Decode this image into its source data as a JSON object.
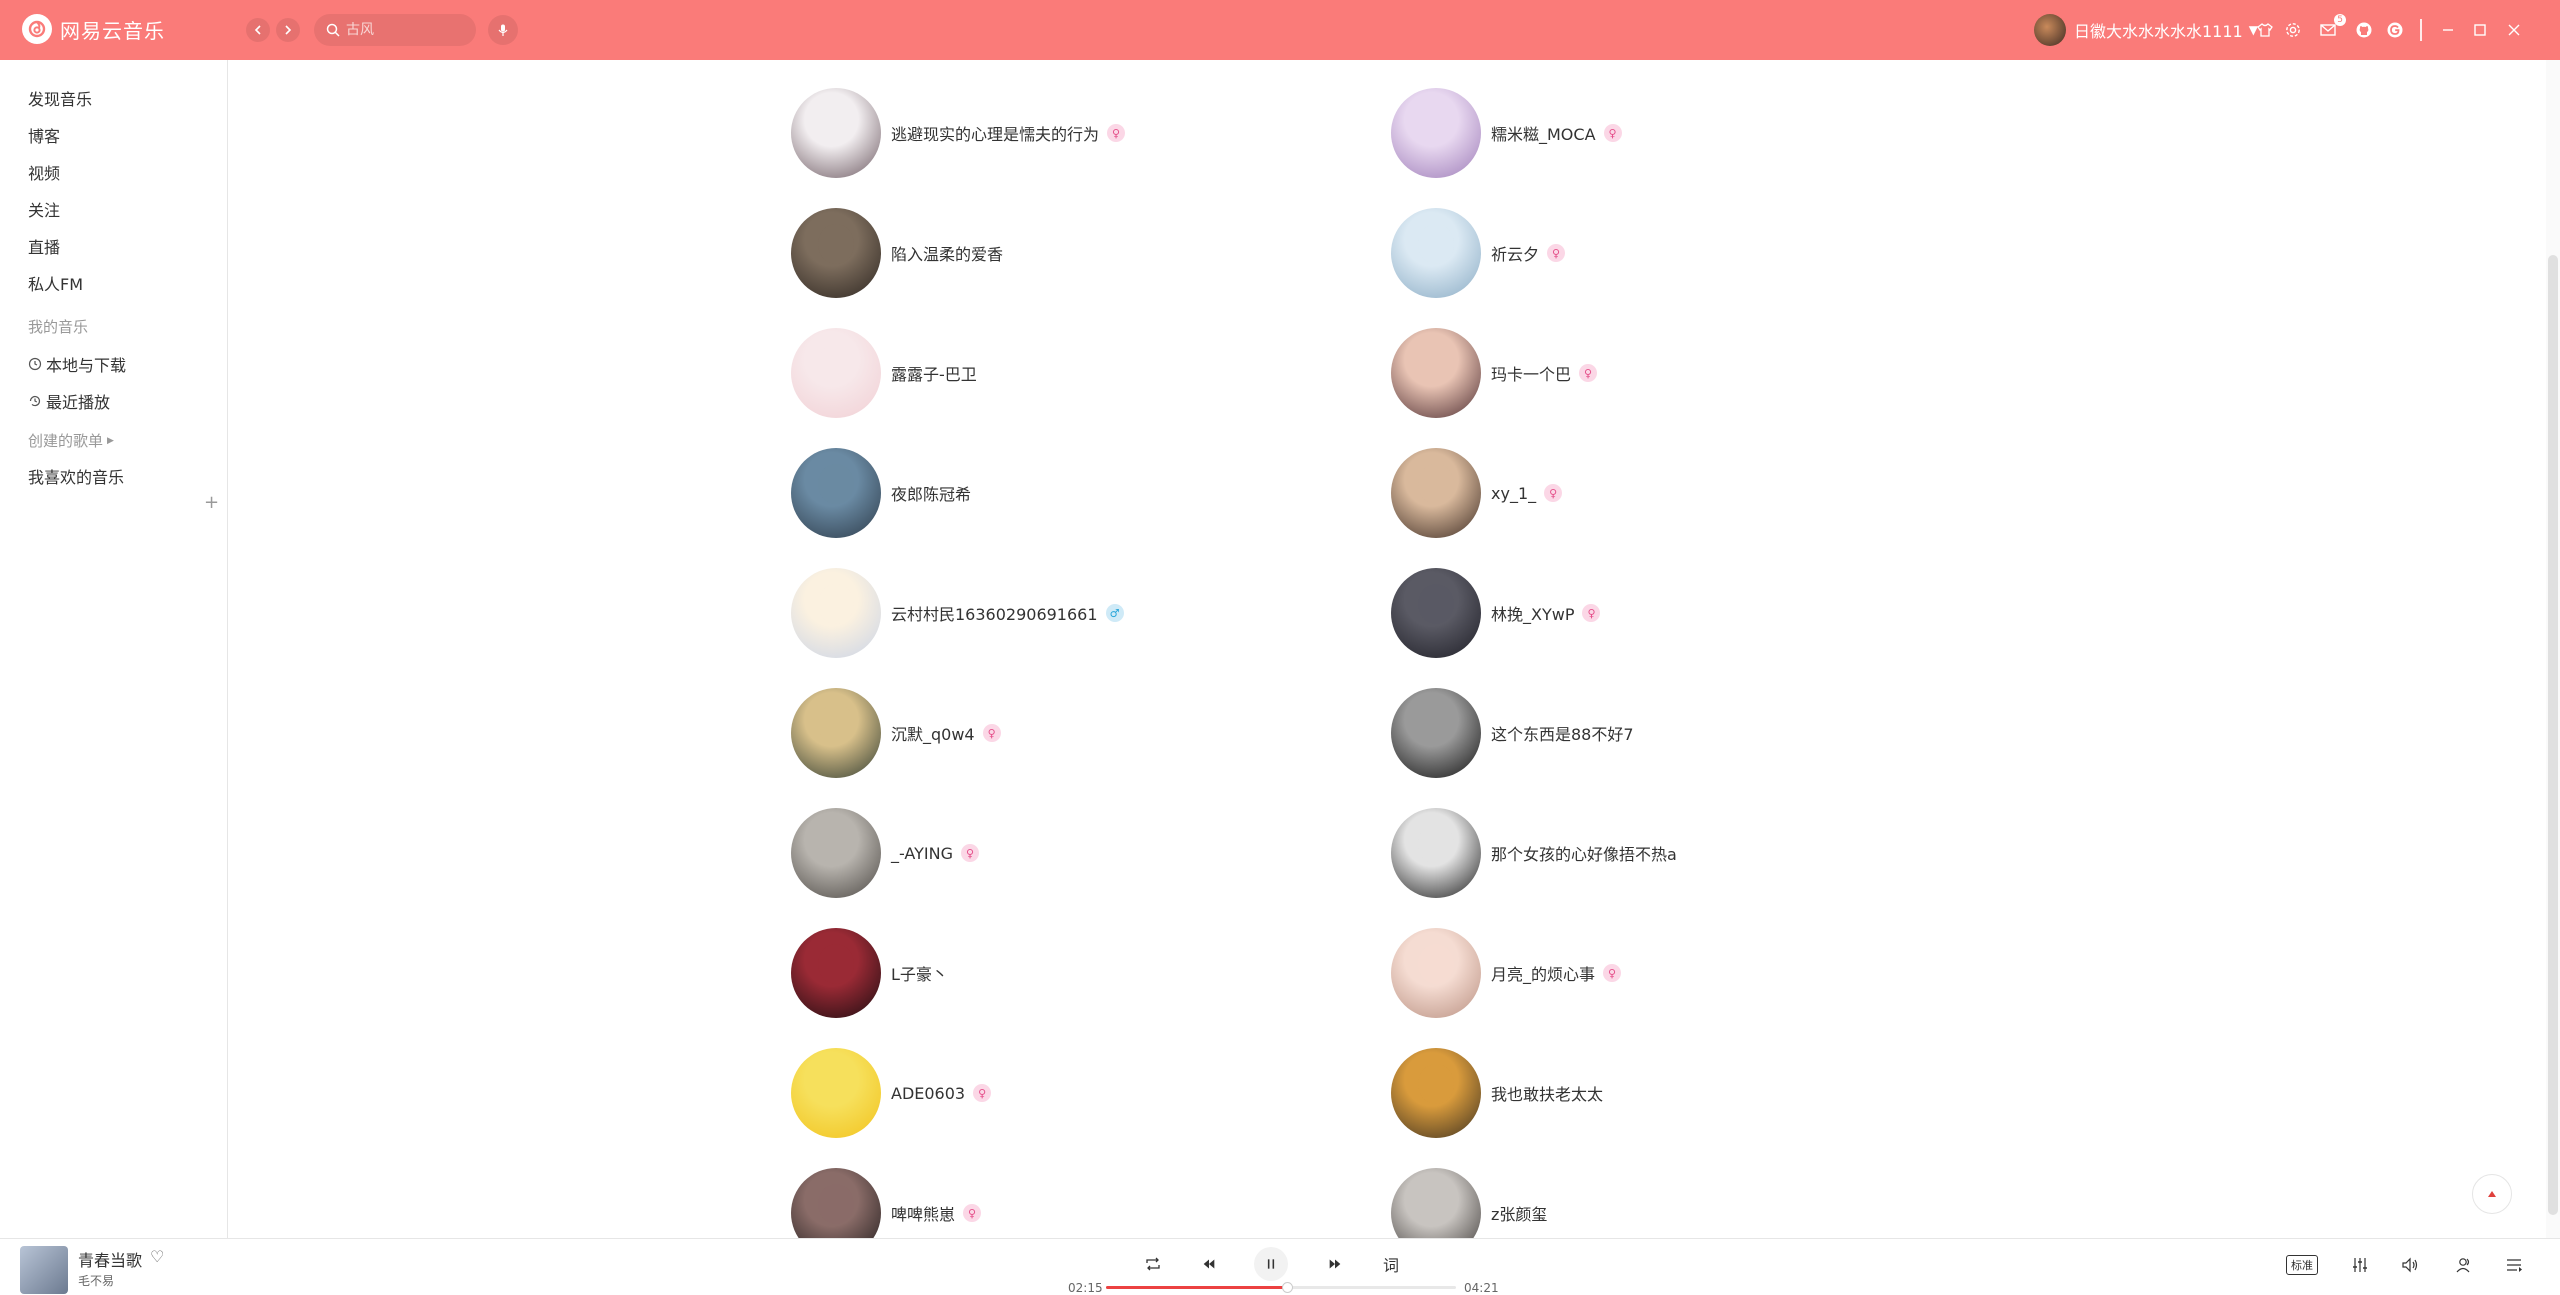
{
  "app": {
    "name": "网易云音乐",
    "accent": "#fa7b79"
  },
  "search": {
    "placeholder": "古风"
  },
  "user": {
    "name": "日徽大水水水水水1111",
    "mail_badge": "5"
  },
  "sidebar": {
    "items": [
      {
        "label": "发现音乐"
      },
      {
        "label": "博客"
      },
      {
        "label": "视频"
      },
      {
        "label": "关注"
      },
      {
        "label": "直播"
      },
      {
        "label": "私人FM"
      }
    ],
    "my_music_title": "我的音乐",
    "my_music": [
      {
        "label": "本地与下载",
        "icon": "download-clock-icon"
      },
      {
        "label": "最近播放",
        "icon": "recent-clock-icon"
      }
    ],
    "created_playlists_title": "创建的歌单",
    "playlists": [
      {
        "label": "我喜欢的音乐"
      }
    ]
  },
  "users": [
    {
      "name": "逃避现实的心理是懦夫的行为",
      "gender": "female",
      "avatar_colors": [
        "#f2eef0",
        "#6b5860"
      ]
    },
    {
      "name": "糯米糍_MOCA",
      "gender": "female",
      "avatar_colors": [
        "#e8d8f0",
        "#9c7bb7"
      ]
    },
    {
      "name": "陷入温柔的爱香",
      "gender": "",
      "avatar_colors": [
        "#7d6d5d",
        "#2c2520"
      ]
    },
    {
      "name": "祈云夕",
      "gender": "female",
      "avatar_colors": [
        "#dbe9f3",
        "#88aac3"
      ]
    },
    {
      "name": "露露子-巴卫",
      "gender": "",
      "avatar_colors": [
        "#f7e8ea",
        "#f1cfd4"
      ]
    },
    {
      "name": "玛卡一个巴",
      "gender": "female",
      "avatar_colors": [
        "#e9c4b4",
        "#4c2c30"
      ]
    },
    {
      "name": "夜郎陈冠希",
      "gender": "",
      "avatar_colors": [
        "#6a8aa3",
        "#2c3a48"
      ]
    },
    {
      "name": "xy_1_",
      "gender": "female",
      "avatar_colors": [
        "#d9b99c",
        "#3b2a22"
      ]
    },
    {
      "name": "云村村民16360290691661",
      "gender": "male",
      "avatar_colors": [
        "#fbf1e0",
        "#c9d3e6"
      ]
    },
    {
      "name": "林挽_XYwP",
      "gender": "female",
      "avatar_colors": [
        "#5a5a64",
        "#1e1e26"
      ]
    },
    {
      "name": "沉默_q0w4",
      "gender": "female",
      "avatar_colors": [
        "#d8c08a",
        "#2e3a30"
      ]
    },
    {
      "name": "这个东西是88不好7",
      "gender": "",
      "avatar_colors": [
        "#9a9a9a",
        "#111111"
      ]
    },
    {
      "name": "_-AYING",
      "gender": "female",
      "avatar_colors": [
        "#b8b4ae",
        "#4a4642"
      ]
    },
    {
      "name": "那个女孩的心好像捂不热a",
      "gender": "",
      "avatar_colors": [
        "#e3e3e3",
        "#1a1a1a"
      ]
    },
    {
      "name": "L子豪丶",
      "gender": "",
      "avatar_colors": [
        "#9a2a35",
        "#1a0c10"
      ]
    },
    {
      "name": "月亮_的烦心事",
      "gender": "female",
      "avatar_colors": [
        "#f5dcd2",
        "#b88f80"
      ]
    },
    {
      "name": "ADE0603",
      "gender": "female",
      "avatar_colors": [
        "#f6e05c",
        "#f2c21c"
      ]
    },
    {
      "name": "我也敢扶老太太",
      "gender": "",
      "avatar_colors": [
        "#d99b3c",
        "#3c3020"
      ]
    },
    {
      "name": "啤啤熊崽",
      "gender": "female",
      "avatar_colors": [
        "#8a6c68",
        "#1e1a1a"
      ]
    },
    {
      "name": "z张颜玺",
      "gender": "",
      "avatar_colors": [
        "#c8c4c0",
        "#3a3634"
      ]
    }
  ],
  "player": {
    "song": "青春当歌",
    "artist": "毛不易",
    "current_time": "02:15",
    "total_time": "04:21",
    "progress": 0.517,
    "lyrics_label": "词",
    "quality_label": "标准"
  }
}
